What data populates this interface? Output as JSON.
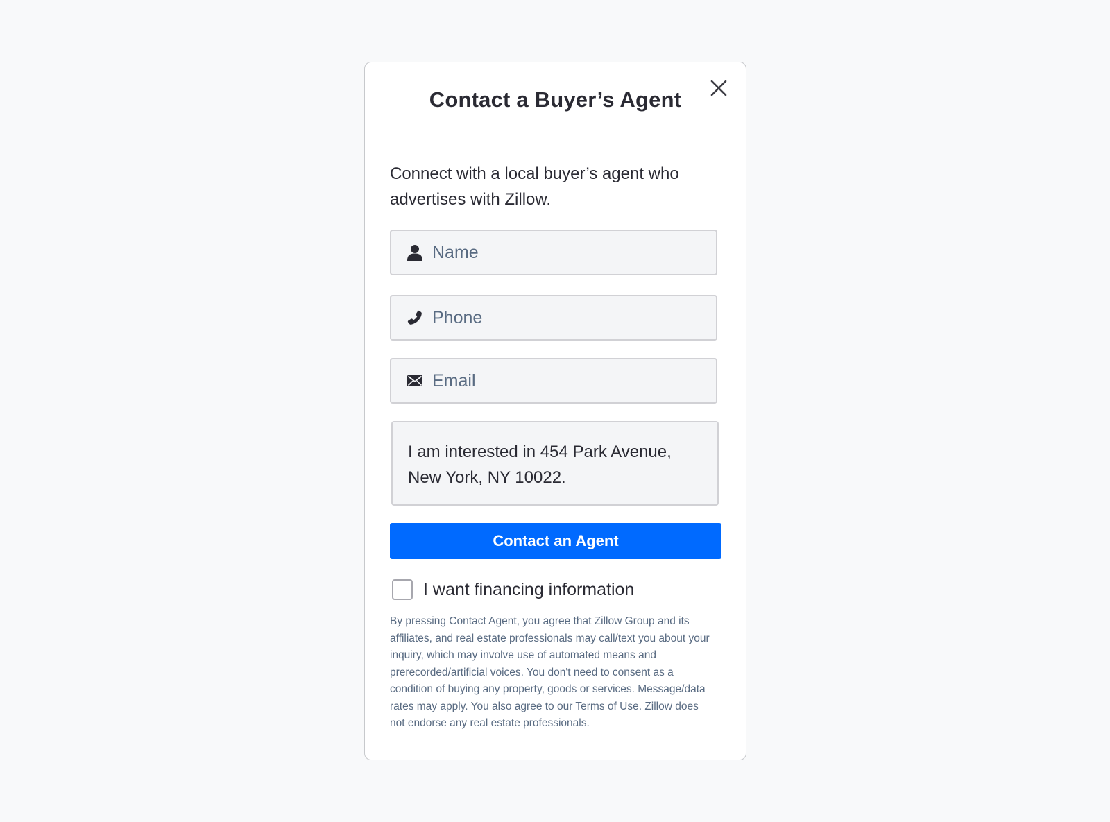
{
  "modal": {
    "title": "Contact a Buyer’s Agent",
    "close_icon": "close-icon",
    "intro": "Connect with a local buyer’s agent who advertises with Zillow.",
    "fields": {
      "name": {
        "placeholder": "Name",
        "value": "",
        "icon": "person-icon"
      },
      "phone": {
        "placeholder": "Phone",
        "value": "",
        "icon": "phone-icon"
      },
      "email": {
        "placeholder": "Email",
        "value": "",
        "icon": "envelope-icon"
      }
    },
    "message": {
      "value": "I am interested in 454 Park Avenue, New York, NY 10022."
    },
    "submit_label": "Contact an Agent",
    "financing": {
      "label": "I want financing information",
      "checked": false
    },
    "disclaimer": "By pressing Contact Agent, you agree that Zillow Group and its affiliates, and real estate professionals may call/text you about your inquiry, which may involve use of automated means and prerecorded/artificial voices. You don't need to consent as a condition of buying any property, goods or services. Message/data rates may apply. You also agree to our Terms of Use. Zillow does not endorse any real estate professionals."
  },
  "colors": {
    "accent": "#006aff",
    "text": "#2a2a33",
    "muted": "#596b82",
    "field_bg": "#f4f5f7",
    "page_bg": "#f8f9fa"
  }
}
